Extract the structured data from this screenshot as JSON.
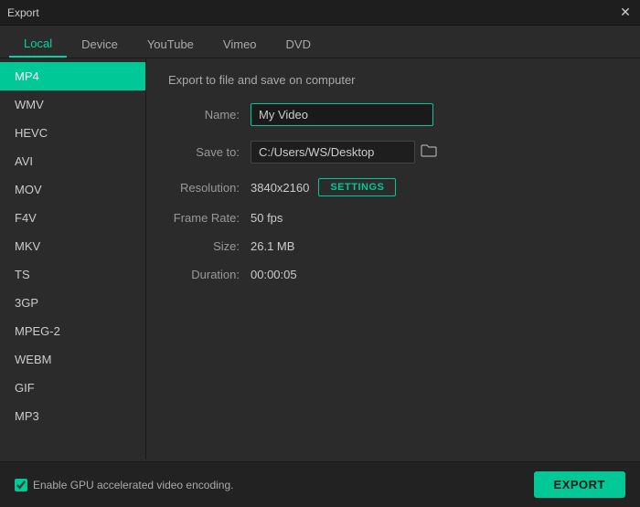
{
  "titleBar": {
    "title": "Export",
    "closeIcon": "✕"
  },
  "tabs": [
    {
      "id": "local",
      "label": "Local",
      "active": true
    },
    {
      "id": "device",
      "label": "Device",
      "active": false
    },
    {
      "id": "youtube",
      "label": "YouTube",
      "active": false
    },
    {
      "id": "vimeo",
      "label": "Vimeo",
      "active": false
    },
    {
      "id": "dvd",
      "label": "DVD",
      "active": false
    }
  ],
  "sidebar": {
    "items": [
      {
        "id": "mp4",
        "label": "MP4",
        "active": true
      },
      {
        "id": "wmv",
        "label": "WMV",
        "active": false
      },
      {
        "id": "hevc",
        "label": "HEVC",
        "active": false
      },
      {
        "id": "avi",
        "label": "AVI",
        "active": false
      },
      {
        "id": "mov",
        "label": "MOV",
        "active": false
      },
      {
        "id": "f4v",
        "label": "F4V",
        "active": false
      },
      {
        "id": "mkv",
        "label": "MKV",
        "active": false
      },
      {
        "id": "ts",
        "label": "TS",
        "active": false
      },
      {
        "id": "3gp",
        "label": "3GP",
        "active": false
      },
      {
        "id": "mpeg2",
        "label": "MPEG-2",
        "active": false
      },
      {
        "id": "webm",
        "label": "WEBM",
        "active": false
      },
      {
        "id": "gif",
        "label": "GIF",
        "active": false
      },
      {
        "id": "mp3",
        "label": "MP3",
        "active": false
      }
    ]
  },
  "panel": {
    "title": "Export to file and save on computer",
    "fields": {
      "name": {
        "label": "Name:",
        "value": "My Video",
        "placeholder": "My Video"
      },
      "saveTo": {
        "label": "Save to:",
        "value": "C:/Users/WS/Desktop",
        "folderIcon": "🗁"
      },
      "resolution": {
        "label": "Resolution:",
        "value": "3840x2160",
        "settingsLabel": "SETTINGS"
      },
      "frameRate": {
        "label": "Frame Rate:",
        "value": "50 fps"
      },
      "size": {
        "label": "Size:",
        "value": "26.1 MB"
      },
      "duration": {
        "label": "Duration:",
        "value": "00:00:05"
      }
    }
  },
  "bottomBar": {
    "gpuLabel": "Enable GPU accelerated video encoding.",
    "gpuChecked": true,
    "exportLabel": "EXPORT"
  }
}
